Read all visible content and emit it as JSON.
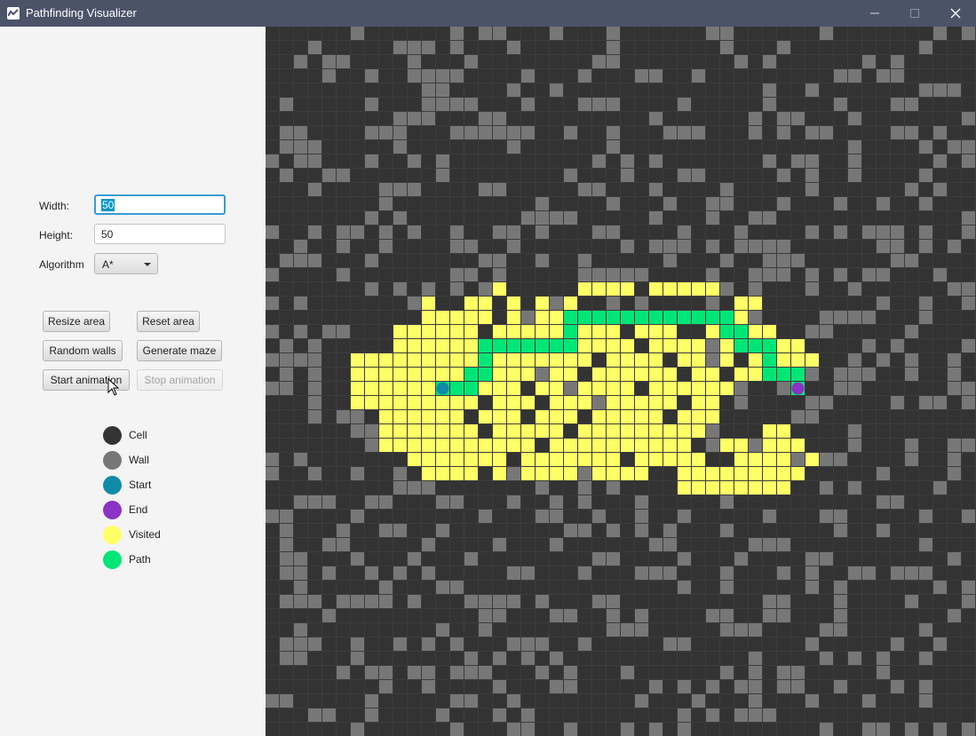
{
  "window": {
    "title": "Pathfinding Visualizer"
  },
  "titlebar": {
    "icon": "app-logo-icon",
    "buttons": [
      "minimize-icon",
      "maximize-icon",
      "close-icon"
    ]
  },
  "form": {
    "width_label": "Width:",
    "width_value": "50",
    "height_label": "Height:",
    "height_value": "50",
    "algorithm_label": "Algorithm",
    "algorithm_value": "A*"
  },
  "buttons": {
    "resize": "Resize area",
    "reset": "Reset area",
    "random_walls": "Random walls",
    "generate_maze": "Generate maze",
    "start": "Start animation",
    "stop": "Stop animation"
  },
  "legend": [
    {
      "label": "Cell",
      "color": "#333333"
    },
    {
      "label": "Wall",
      "color": "#777777"
    },
    {
      "label": "Start",
      "color": "#0f8ba8"
    },
    {
      "label": "End",
      "color": "#8b33c7"
    },
    {
      "label": "Visited",
      "color": "#ffff66"
    },
    {
      "label": "Path",
      "color": "#00e676"
    }
  ],
  "grid": {
    "columns": 50,
    "rows": 50,
    "colors": {
      "cell": "#333333",
      "wall": "#777777",
      "visited": "#ffff66",
      "path": "#00e676",
      "start": "#0f8ba8",
      "end": "#8b33c7",
      "line": "#3c3c3c"
    },
    "start": [
      12,
      25
    ],
    "end": [
      37,
      25
    ],
    "path": [
      [
        12,
        25
      ],
      [
        13,
        25
      ],
      [
        14,
        25
      ],
      [
        14,
        24
      ],
      [
        15,
        24
      ],
      [
        15,
        23
      ],
      [
        15,
        22
      ],
      [
        16,
        22
      ],
      [
        17,
        22
      ],
      [
        18,
        22
      ],
      [
        19,
        22
      ],
      [
        20,
        22
      ],
      [
        21,
        22
      ],
      [
        21,
        21
      ],
      [
        21,
        20
      ],
      [
        22,
        20
      ],
      [
        23,
        20
      ],
      [
        24,
        20
      ],
      [
        25,
        20
      ],
      [
        26,
        20
      ],
      [
        27,
        20
      ],
      [
        28,
        20
      ],
      [
        29,
        20
      ],
      [
        30,
        20
      ],
      [
        31,
        20
      ],
      [
        32,
        20
      ],
      [
        32,
        21
      ],
      [
        33,
        21
      ],
      [
        33,
        22
      ],
      [
        34,
        22
      ],
      [
        35,
        22
      ],
      [
        35,
        23
      ],
      [
        35,
        24
      ],
      [
        36,
        24
      ],
      [
        37,
        24
      ],
      [
        37,
        25
      ]
    ],
    "visited_spans": [
      {
        "row": 18,
        "ranges": [
          [
            16,
            16
          ],
          [
            22,
            25
          ],
          [
            27,
            31
          ]
        ]
      },
      {
        "row": 19,
        "ranges": [
          [
            11,
            11
          ],
          [
            14,
            15
          ],
          [
            17,
            17
          ],
          [
            19,
            19
          ],
          [
            21,
            21
          ],
          [
            33,
            34
          ]
        ]
      },
      {
        "row": 20,
        "ranges": [
          [
            11,
            15
          ],
          [
            17,
            17
          ],
          [
            19,
            20
          ],
          [
            32,
            33
          ]
        ]
      },
      {
        "row": 21,
        "ranges": [
          [
            9,
            14
          ],
          [
            16,
            20
          ],
          [
            22,
            24
          ],
          [
            26,
            28
          ],
          [
            31,
            32
          ],
          [
            34,
            35
          ]
        ]
      },
      {
        "row": 22,
        "ranges": [
          [
            9,
            14
          ],
          [
            16,
            16
          ],
          [
            22,
            25
          ],
          [
            27,
            30
          ],
          [
            32,
            32
          ],
          [
            36,
            37
          ]
        ]
      },
      {
        "row": 23,
        "ranges": [
          [
            6,
            14
          ],
          [
            16,
            22
          ],
          [
            24,
            27
          ],
          [
            29,
            30
          ],
          [
            32,
            32
          ],
          [
            34,
            34
          ],
          [
            36,
            38
          ]
        ]
      },
      {
        "row": 24,
        "ranges": [
          [
            6,
            14
          ],
          [
            16,
            18
          ],
          [
            20,
            21
          ],
          [
            23,
            28
          ],
          [
            30,
            31
          ],
          [
            33,
            34
          ],
          [
            36,
            36
          ]
        ]
      },
      {
        "row": 25,
        "ranges": [
          [
            6,
            11
          ],
          [
            15,
            17
          ],
          [
            19,
            20
          ],
          [
            22,
            25
          ],
          [
            27,
            30
          ],
          [
            31,
            32
          ]
        ]
      },
      {
        "row": 26,
        "ranges": [
          [
            6,
            14
          ],
          [
            16,
            18
          ],
          [
            20,
            22
          ],
          [
            24,
            28
          ],
          [
            30,
            31
          ]
        ]
      },
      {
        "row": 27,
        "ranges": [
          [
            8,
            13
          ],
          [
            15,
            17
          ],
          [
            19,
            21
          ],
          [
            23,
            27
          ],
          [
            29,
            31
          ]
        ]
      },
      {
        "row": 28,
        "ranges": [
          [
            8,
            14
          ],
          [
            16,
            20
          ],
          [
            22,
            30
          ],
          [
            35,
            36
          ]
        ]
      },
      {
        "row": 29,
        "ranges": [
          [
            8,
            18
          ],
          [
            20,
            29
          ],
          [
            32,
            33
          ],
          [
            35,
            37
          ]
        ]
      },
      {
        "row": 30,
        "ranges": [
          [
            10,
            16
          ],
          [
            18,
            24
          ],
          [
            26,
            30
          ],
          [
            33,
            36
          ],
          [
            38,
            38
          ]
        ]
      },
      {
        "row": 31,
        "ranges": [
          [
            11,
            14
          ],
          [
            16,
            16
          ],
          [
            18,
            21
          ],
          [
            23,
            26
          ],
          [
            29,
            37
          ]
        ]
      },
      {
        "row": 32,
        "ranges": [
          [
            29,
            36
          ]
        ]
      }
    ]
  }
}
